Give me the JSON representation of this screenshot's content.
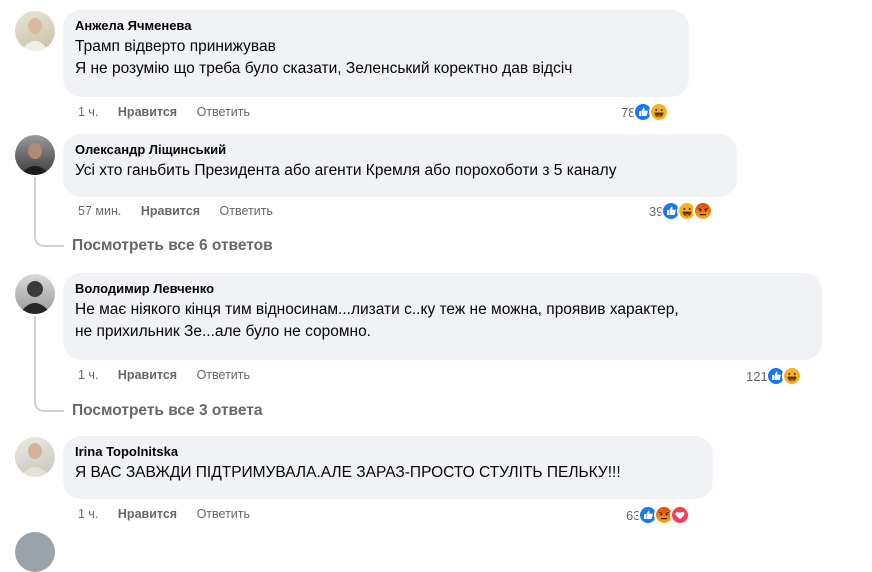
{
  "comments": [
    {
      "author": "Анжела Ячменева",
      "lines": [
        "Трамп відверто принижував",
        "Я не розумію що треба було сказати, Зеленський коректно дав відсіч"
      ],
      "time": "1 ч.",
      "like": "Нравится",
      "reply": "Ответить",
      "reactions_count": "78",
      "reactions": [
        "like-icon",
        "haha-icon"
      ]
    },
    {
      "author": "Олександр Ліщинський",
      "lines": [
        "Усі хто ганьбить Президента або агенти Кремля або порохоботи з 5 каналу"
      ],
      "time": "57 мин.",
      "like": "Нравится",
      "reply": "Ответить",
      "reactions_count": "39",
      "reactions": [
        "like-icon",
        "haha-icon",
        "angry-icon"
      ],
      "view_replies": "Посмотреть все 6 ответов"
    },
    {
      "author": "Володимир Левченко",
      "lines": [
        "Не має ніякого кінця тим відносинам...лизати с..ку теж не можна, проявив характер,",
        "не прихильник Зе...але було не соромно."
      ],
      "time": "1 ч.",
      "like": "Нравится",
      "reply": "Ответить",
      "reactions_count": "121",
      "reactions": [
        "like-icon",
        "haha-icon"
      ],
      "view_replies": "Посмотреть все 3 ответа"
    },
    {
      "author": "Irina Topolnitska",
      "lines": [
        "Я ВАС ЗАВЖДИ ПІДТРИМУВАЛА.АЛЕ ЗАРАЗ-ПРОСТО СТУЛІТЬ ПЕЛЬКУ!!!"
      ],
      "time": "1 ч.",
      "like": "Нравится",
      "reply": "Ответить",
      "reactions_count": "63",
      "reactions": [
        "like-icon",
        "angry-icon",
        "love-icon"
      ]
    }
  ],
  "colors": {
    "bubble": "#f0f2f5",
    "meta": "#65676b",
    "like": "#1877f2",
    "haha": "#f7b125",
    "angry": "#e9710f",
    "love": "#f33e58"
  }
}
